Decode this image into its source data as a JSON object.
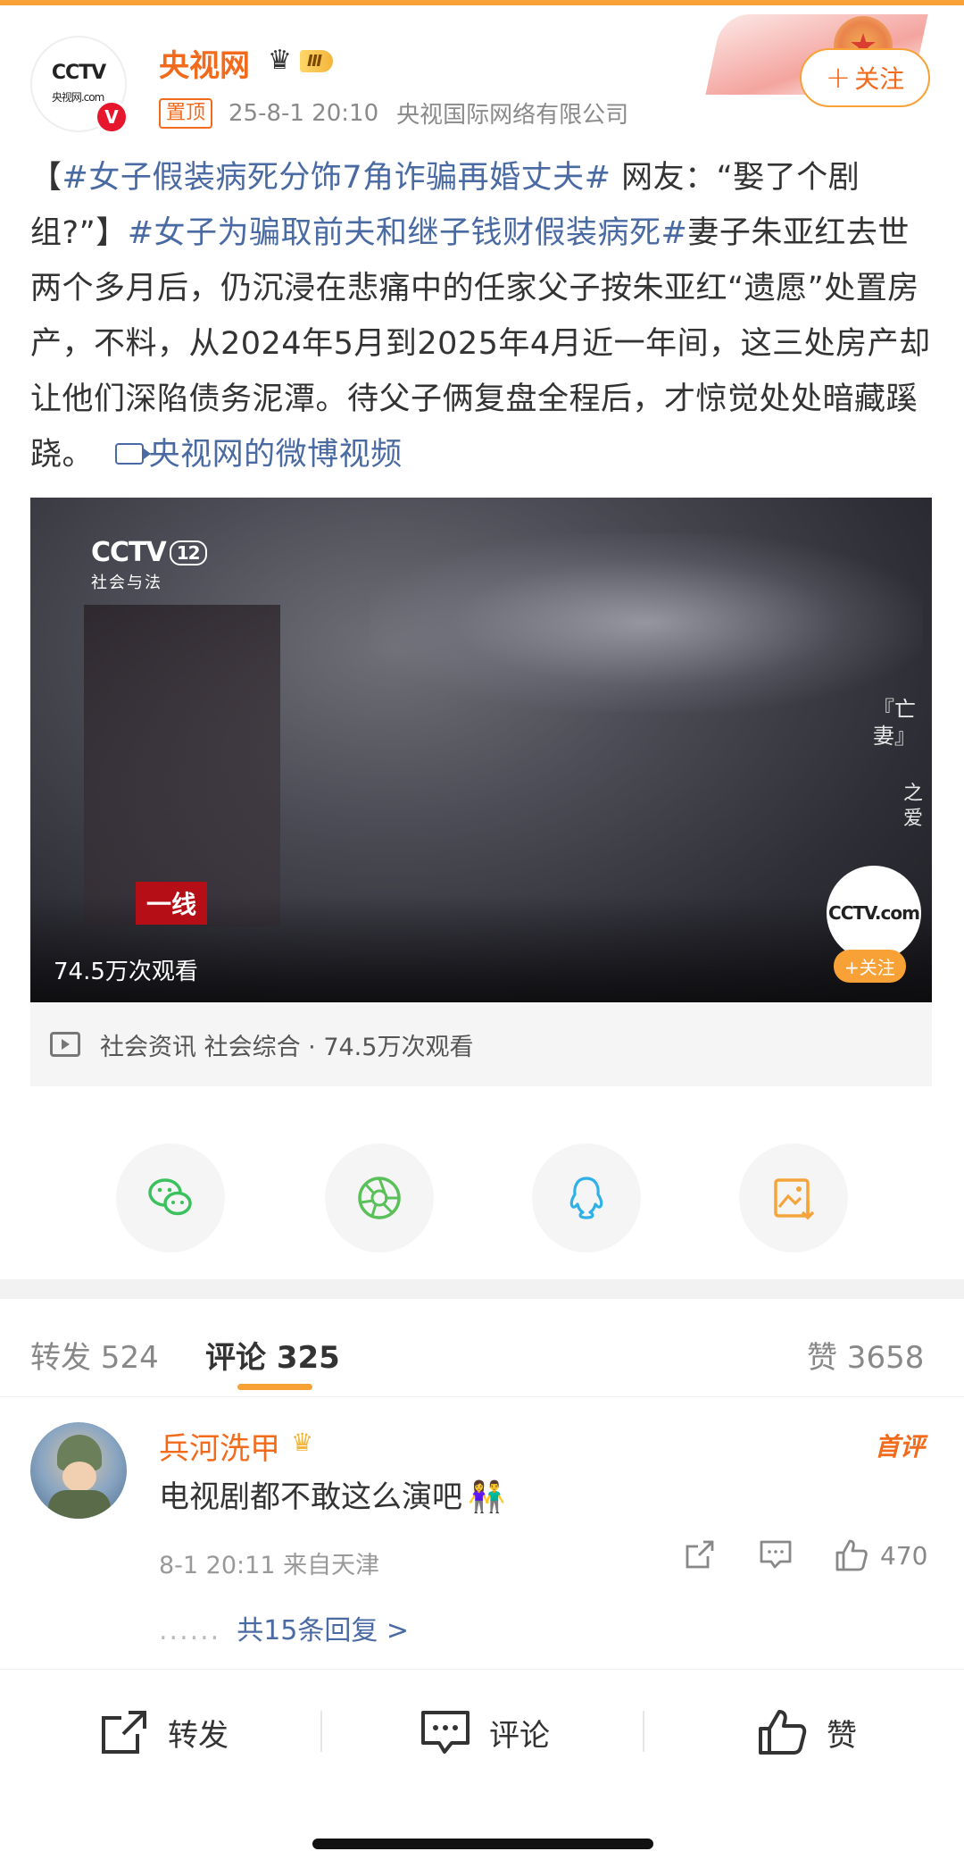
{
  "post": {
    "author": {
      "name": "央视网",
      "avatar_logo": "CCTV",
      "avatar_logo_sub": "央视网.com",
      "verified_badge": "V",
      "vip_level": "Ⅲ"
    },
    "pin_label": "置顶",
    "time": "25-8-1 20:10",
    "source": "央视国际网络有限公司",
    "follow_label": "关注",
    "text": {
      "part1": "【",
      "tag1": "#女子假装病死分饰7角诈骗再婚丈夫#",
      "part2": " 网友：“娶了个剧组?”】",
      "tag2": "#女子为骗取前夫和继子钱财假装病死#",
      "part3": "妻子朱亚红去世两个多月后，仍沉浸在悲痛中的任家父子按朱亚红“遗愿”处置房产，不料，从2024年5月到2025年4月近一年间，这三处房产却让他们深陷债务泥潭。待父子俩复盘全程后，才惊觉处处暗藏蹊跷。",
      "video_link": "央视网的微博视频"
    },
    "video": {
      "channel_logo": "CCTV",
      "channel_number": "12",
      "channel_name": "社会与法",
      "segment_tag": "一线",
      "vertical_title": "『亡妻』",
      "vertical_subtitle": "之爱",
      "watermark": "CCTV.com",
      "overlay_follow": "+关注",
      "view_count": "74.5万次观看"
    },
    "video_meta": "社会资讯 社会综合 · 74.5万次观看"
  },
  "share": [
    {
      "name": "wechat-icon",
      "color": "#3cc15f"
    },
    {
      "name": "moments-icon",
      "color": "#5ac05a"
    },
    {
      "name": "qq-icon",
      "color": "#2fb1e8"
    },
    {
      "name": "save-image-icon",
      "color": "#f3a53b"
    }
  ],
  "tabs": {
    "repost": "转发 524",
    "comment_label": "评论",
    "comment_count": "325",
    "likes": "赞 3658"
  },
  "comment": {
    "user": "兵河洗甲",
    "first_badge": "首评",
    "text": "电视剧都不敢这么演吧",
    "emoji": "👫",
    "meta": "8-1 20:11  来自天津",
    "like_count": "470",
    "replies": "共15条回复 >",
    "replies_dots": "......"
  },
  "bottom_bar": {
    "repost": "转发",
    "comment": "评论",
    "like": "赞"
  },
  "colors": {
    "accent_orange": "#f26b1d",
    "link_blue": "#4a6aa3",
    "tab_underline": "#f7a136"
  }
}
